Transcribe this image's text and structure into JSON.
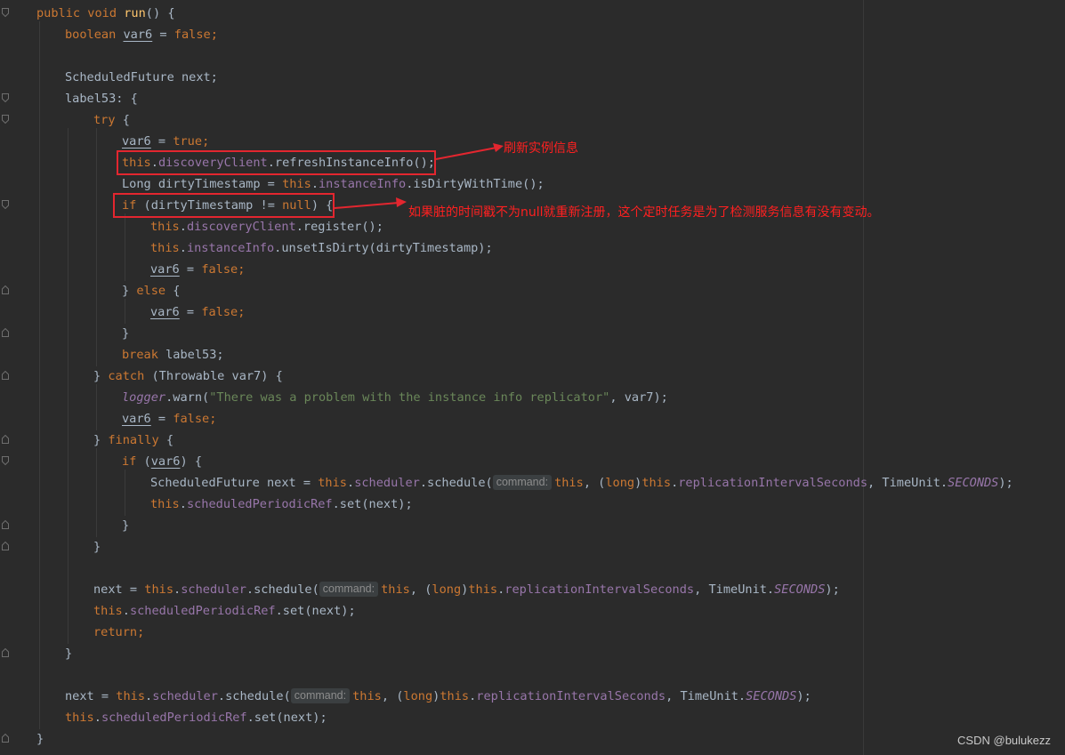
{
  "colors": {
    "background": "#2b2b2b",
    "keyword": "#cc7832",
    "method": "#ffc66d",
    "field": "#9876aa",
    "string": "#6a8759",
    "text": "#a9b7c6",
    "annotation": "#ff2020"
  },
  "code": {
    "l1": {
      "kw": "public void",
      "fn": "run",
      "rest": "() {"
    },
    "l2": {
      "kw": "boolean",
      "var": "var6",
      "op": " = ",
      "val": "false",
      "end": ";"
    },
    "l3": {
      "text": "ScheduledFuture next;"
    },
    "l4": {
      "text": "label53: {"
    },
    "l5": {
      "kw": "try",
      "rest": " {"
    },
    "l6": {
      "var": "var6",
      "op": " = ",
      "val": "true",
      "end": ";"
    },
    "l7": {
      "this": "this",
      "dot1": ".",
      "field": "discoveryClient",
      "rest": ".refreshInstanceInfo();"
    },
    "l8": {
      "pre": "Long dirtyTimestamp = ",
      "this": "this",
      "dot1": ".",
      "field": "instanceInfo",
      "rest": ".isDirtyWithTime();"
    },
    "l9": {
      "kw": "if",
      "mid": " (dirtyTimestamp != ",
      "val": "null",
      "end": ") {"
    },
    "l10": {
      "this": "this",
      "dot1": ".",
      "field": "discoveryClient",
      "rest": ".register();"
    },
    "l11": {
      "this": "this",
      "dot1": ".",
      "field": "instanceInfo",
      "rest": ".unsetIsDirty(dirtyTimestamp);"
    },
    "l12": {
      "var": "var6",
      "op": " = ",
      "val": "false",
      "end": ";"
    },
    "l13": {
      "pre": "} ",
      "kw": "else",
      "rest": " {"
    },
    "l14": {
      "var": "var6",
      "op": " = ",
      "val": "false",
      "end": ";"
    },
    "l15": {
      "text": "}"
    },
    "l16": {
      "kw": "break",
      "rest": " label53;"
    },
    "l17": {
      "pre": "} ",
      "kw": "catch",
      "rest": " (Throwable var7) {"
    },
    "l18": {
      "field": "logger",
      "mid": ".warn(",
      "str": "\"There was a problem with the instance info replicator\"",
      "end": ", var7);"
    },
    "l19": {
      "var": "var6",
      "op": " = ",
      "val": "false",
      "end": ";"
    },
    "l20": {
      "pre": "} ",
      "kw": "finally",
      "rest": " {"
    },
    "l21": {
      "kw": "if",
      "open": " (",
      "var": "var6",
      "end": ") {"
    },
    "l22": {
      "pre": "ScheduledFuture next = ",
      "this": "this",
      "dot1": ".",
      "field": "scheduler",
      "call": ".schedule(",
      "hint": "command:",
      "this2": "this",
      "comma": ", (",
      "kw2": "long",
      "close": ")",
      "this3": "this",
      "dot2": ".",
      "field2": "replicationIntervalSeconds",
      "mid2": ", TimeUnit.",
      "static": "SECONDS",
      "end": ");"
    },
    "l23": {
      "this": "this",
      "dot1": ".",
      "field": "scheduledPeriodicRef",
      "rest": ".set(next);"
    },
    "l24": {
      "text": "}"
    },
    "l25": {
      "text": "}"
    },
    "l26": {
      "pre": "next = ",
      "this": "this",
      "dot1": ".",
      "field": "scheduler",
      "call": ".schedule(",
      "hint": "command:",
      "this2": "this",
      "comma": ", (",
      "kw2": "long",
      "close": ")",
      "this3": "this",
      "dot2": ".",
      "field2": "replicationIntervalSeconds",
      "mid2": ", TimeUnit.",
      "static": "SECONDS",
      "end": ");"
    },
    "l27": {
      "this": "this",
      "dot1": ".",
      "field": "scheduledPeriodicRef",
      "rest": ".set(next);"
    },
    "l28": {
      "kw": "return",
      "end": ";"
    },
    "l29": {
      "text": "}"
    },
    "l30": {
      "pre": "next = ",
      "this": "this",
      "dot1": ".",
      "field": "scheduler",
      "call": ".schedule(",
      "hint": "command:",
      "this2": "this",
      "comma": ", (",
      "kw2": "long",
      "close": ")",
      "this3": "this",
      "dot2": ".",
      "field2": "replicationIntervalSeconds",
      "mid2": ", TimeUnit.",
      "static": "SECONDS",
      "end": ");"
    },
    "l31": {
      "this": "this",
      "dot1": ".",
      "field": "scheduledPeriodicRef",
      "rest": ".set(next);"
    },
    "l32": {
      "text": "}"
    }
  },
  "annotations": {
    "refresh_note": "刷新实例信息",
    "dirty_note": "如果脏的时间戳不为null就重新注册，这个定时任务是为了检测服务信息有没有变动。"
  },
  "watermark": "CSDN @bulukezz"
}
